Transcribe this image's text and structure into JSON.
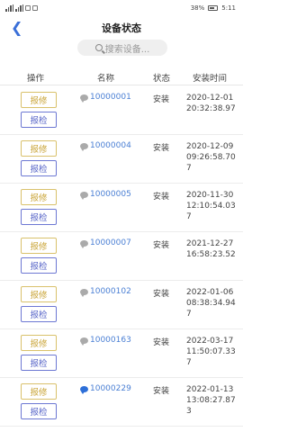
{
  "status_bar": {
    "battery": "38%",
    "time": "5:11"
  },
  "nav": {
    "back_icon": "chevron-left-icon",
    "title": "设备状态"
  },
  "search": {
    "placeholder": "搜索设备..."
  },
  "table": {
    "headers": {
      "action": "操作",
      "name": "名称",
      "status": "状态",
      "install_time": "安装时间"
    },
    "rows": [
      {
        "warn_label": "报修",
        "check_label": "报检",
        "name": "10000001",
        "status": "安装",
        "time": "2020-12-01 20:32:38.97",
        "icon_color": "#aaaaaa"
      },
      {
        "warn_label": "报修",
        "check_label": "报检",
        "name": "10000004",
        "status": "安装",
        "time": "2020-12-09 09:26:58.707",
        "icon_color": "#aaaaaa"
      },
      {
        "warn_label": "报修",
        "check_label": "报检",
        "name": "10000005",
        "status": "安装",
        "time": "2020-11-30 12:10:54.037",
        "icon_color": "#aaaaaa"
      },
      {
        "warn_label": "报修",
        "check_label": "报检",
        "name": "10000007",
        "status": "安装",
        "time": "2021-12-27 16:58:23.52",
        "icon_color": "#aaaaaa"
      },
      {
        "warn_label": "报修",
        "check_label": "报检",
        "name": "10000102",
        "status": "安装",
        "time": "2022-01-06 08:38:34.947",
        "icon_color": "#aaaaaa"
      },
      {
        "warn_label": "报修",
        "check_label": "报检",
        "name": "10000163",
        "status": "安装",
        "time": "2022-03-17 11:50:07.337",
        "icon_color": "#aaaaaa"
      },
      {
        "warn_label": "报修",
        "check_label": "报检",
        "name": "10000229",
        "status": "安装",
        "time": "2022-01-13 13:08:27.873",
        "icon_color": "#2d6fd8"
      }
    ]
  }
}
